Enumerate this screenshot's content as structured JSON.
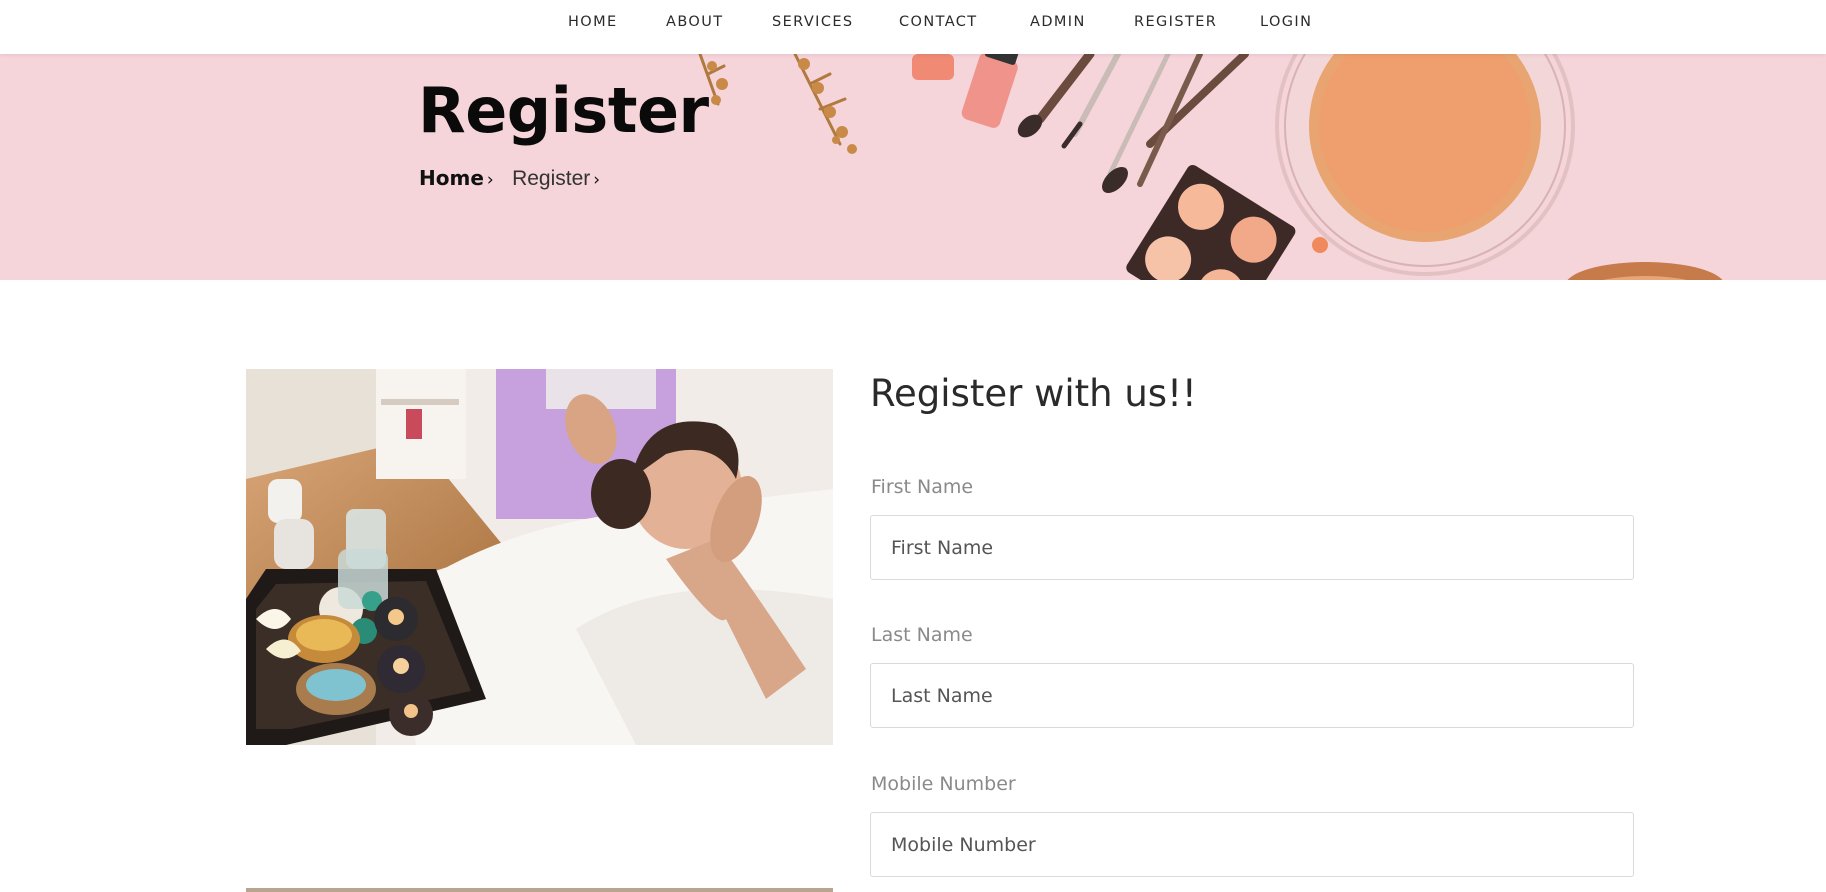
{
  "nav": {
    "items": [
      {
        "label": "HOME"
      },
      {
        "label": "ABOUT"
      },
      {
        "label": "SERVICES"
      },
      {
        "label": "CONTACT"
      },
      {
        "label": "ADMIN"
      },
      {
        "label": "REGISTER"
      },
      {
        "label": "LOGIN"
      }
    ]
  },
  "banner": {
    "title": "Register",
    "breadcrumb": {
      "home": "Home",
      "current": "Register",
      "separator": "›"
    },
    "background_color": "#f5d4da"
  },
  "form": {
    "title": "Register with us!!",
    "fields": [
      {
        "label": "First Name",
        "placeholder": "First Name"
      },
      {
        "label": "Last Name",
        "placeholder": "Last Name"
      },
      {
        "label": "Mobile Number",
        "placeholder": "Mobile Number"
      }
    ]
  },
  "images": {
    "spa_photo": "spa-massage-photo",
    "banner_decor": "cosmetics-flatlay"
  }
}
